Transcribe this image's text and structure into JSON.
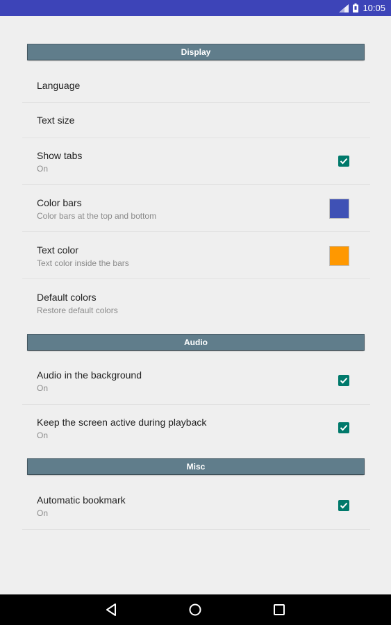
{
  "status_bar": {
    "time": "10:05"
  },
  "sections": {
    "display": {
      "header": "Display",
      "language": {
        "title": "Language"
      },
      "text_size": {
        "title": "Text size"
      },
      "show_tabs": {
        "title": "Show tabs",
        "summary": "On",
        "checked": true
      },
      "color_bars": {
        "title": "Color bars",
        "summary": "Color bars at the top and bottom",
        "color": "#3f51b5"
      },
      "text_color": {
        "title": "Text color",
        "summary": "Text color inside the bars",
        "color": "#ff9800"
      },
      "default_colors": {
        "title": "Default colors",
        "summary": "Restore default colors"
      }
    },
    "audio": {
      "header": "Audio",
      "background": {
        "title": "Audio in the background",
        "summary": "On",
        "checked": true
      },
      "screen_active": {
        "title": "Keep the screen active during playback",
        "summary": "On",
        "checked": true
      }
    },
    "misc": {
      "header": "Misc",
      "auto_bookmark": {
        "title": "Automatic bookmark",
        "summary": "On",
        "checked": true
      }
    }
  },
  "colors": {
    "status_bar": "#3d44b8",
    "section_header": "#607d8b",
    "checkbox": "#00796b"
  },
  "nav": {
    "back_icon": "triangle-back-icon",
    "home_icon": "circle-home-icon",
    "recents_icon": "square-recents-icon"
  }
}
